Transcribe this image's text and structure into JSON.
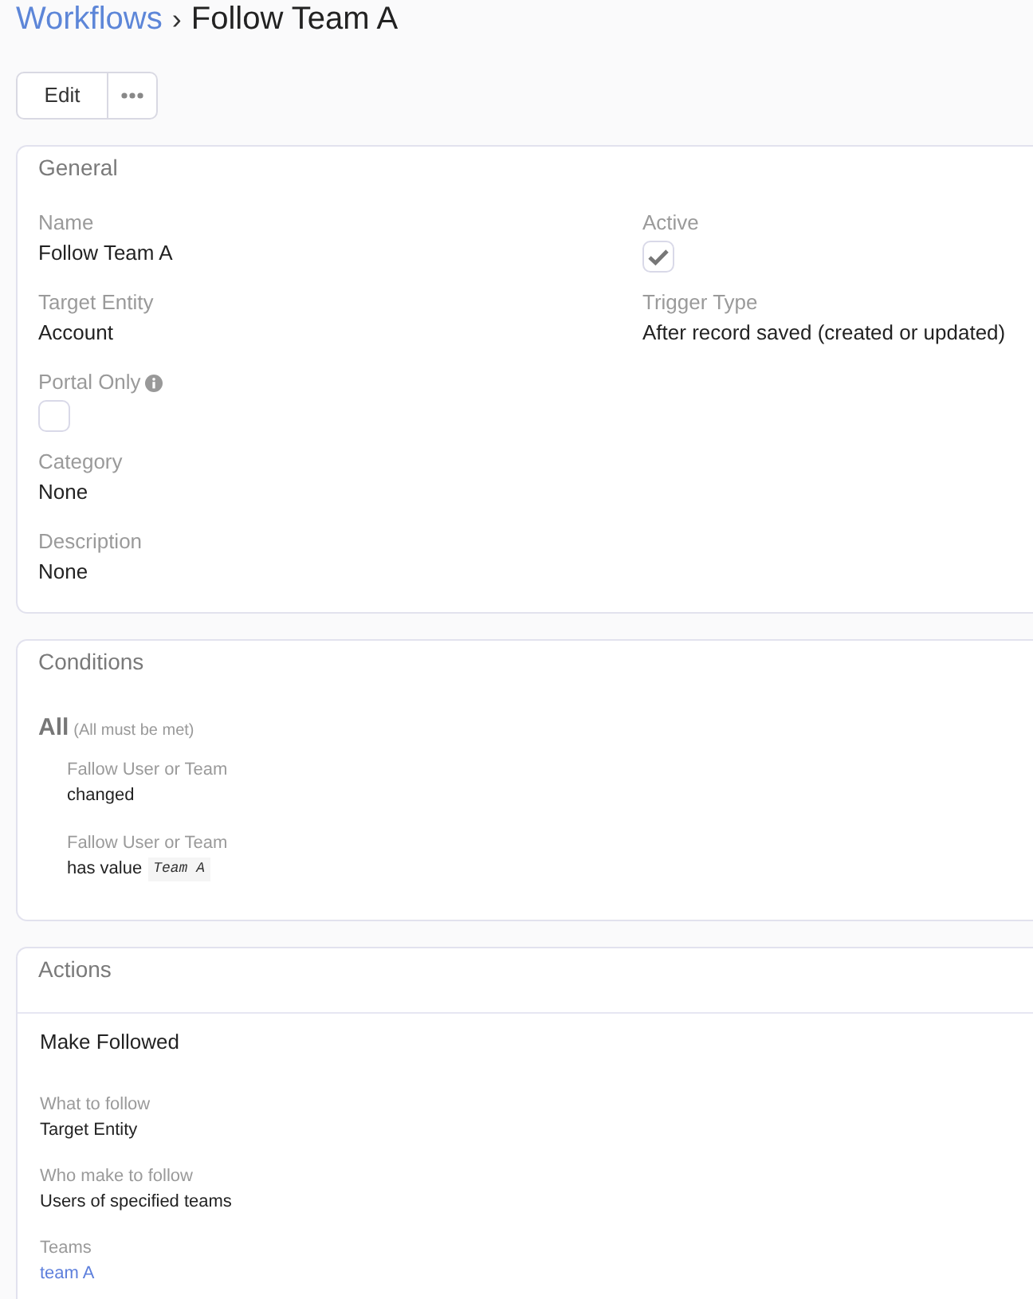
{
  "header": {
    "breadcrumb": "Workflows",
    "separator": "›",
    "title": "Follow Team A"
  },
  "toolbar": {
    "edit": "Edit"
  },
  "general": {
    "title": "General",
    "columns": [
      [
        {
          "kind": "text",
          "label": "Name",
          "value": "Follow Team A"
        },
        {
          "kind": "text",
          "label": "Target Entity",
          "value": "Account"
        },
        {
          "kind": "checkbox",
          "label": "Portal Only",
          "info": true,
          "checked": false
        },
        {
          "kind": "text",
          "label": "Category",
          "value": "None"
        },
        {
          "kind": "text",
          "label": "Description",
          "value": "None"
        }
      ],
      [
        {
          "kind": "checkbox",
          "label": "Active",
          "checked": true
        },
        {
          "kind": "text",
          "label": "Trigger Type",
          "value": "After record saved (created or updated)"
        }
      ]
    ]
  },
  "conditions": {
    "title": "Conditions",
    "operator": "All",
    "note": "(All must be met)",
    "items": [
      {
        "field": "Fallow User or Team",
        "comparison": "changed"
      },
      {
        "field": "Fallow User or Team",
        "comparison": "has value",
        "value": "Team A"
      }
    ]
  },
  "actions": {
    "title": "Actions",
    "items": [
      {
        "name": "Make Followed",
        "fields": [
          {
            "kind": "text",
            "label": "What to follow",
            "value": "Target Entity"
          },
          {
            "kind": "text",
            "label": "Who make to follow",
            "value": "Users of specified teams"
          },
          {
            "kind": "link",
            "label": "Teams",
            "value": "team A"
          }
        ]
      }
    ]
  }
}
